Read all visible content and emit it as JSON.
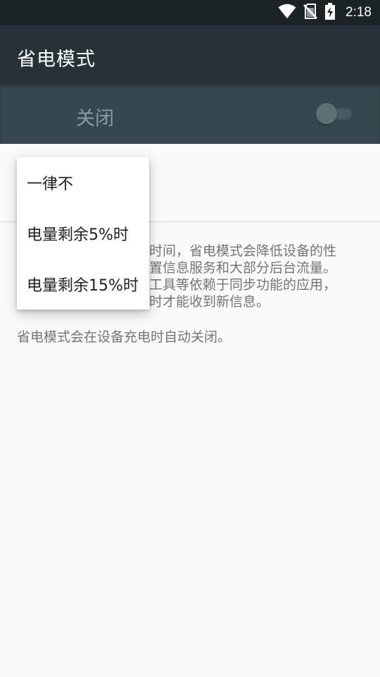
{
  "status_bar": {
    "time": "2:18",
    "icons": [
      "wifi-icon",
      "no-sim-icon",
      "battery-charging-icon"
    ]
  },
  "app_bar": {
    "title": "省电模式"
  },
  "master_switch": {
    "label": "关闭",
    "checked": false
  },
  "summary_lines": [
    "时间，省电模式会降低设备的性",
    "置信息服务和大部分后台流量。",
    "工具等依赖于同步功能的应用，",
    "时才能收到新信息。"
  ],
  "footnote": "省电模式会在设备充电时自动关闭。",
  "dropdown_menu": {
    "items": [
      {
        "label": "一律不"
      },
      {
        "label": "电量剩余5%时"
      },
      {
        "label": "电量剩余15%时"
      }
    ]
  },
  "colors": {
    "status_bar": "#1c2327",
    "app_bar": "#263238",
    "master_bar": "#37474f",
    "background": "#fafafa"
  }
}
